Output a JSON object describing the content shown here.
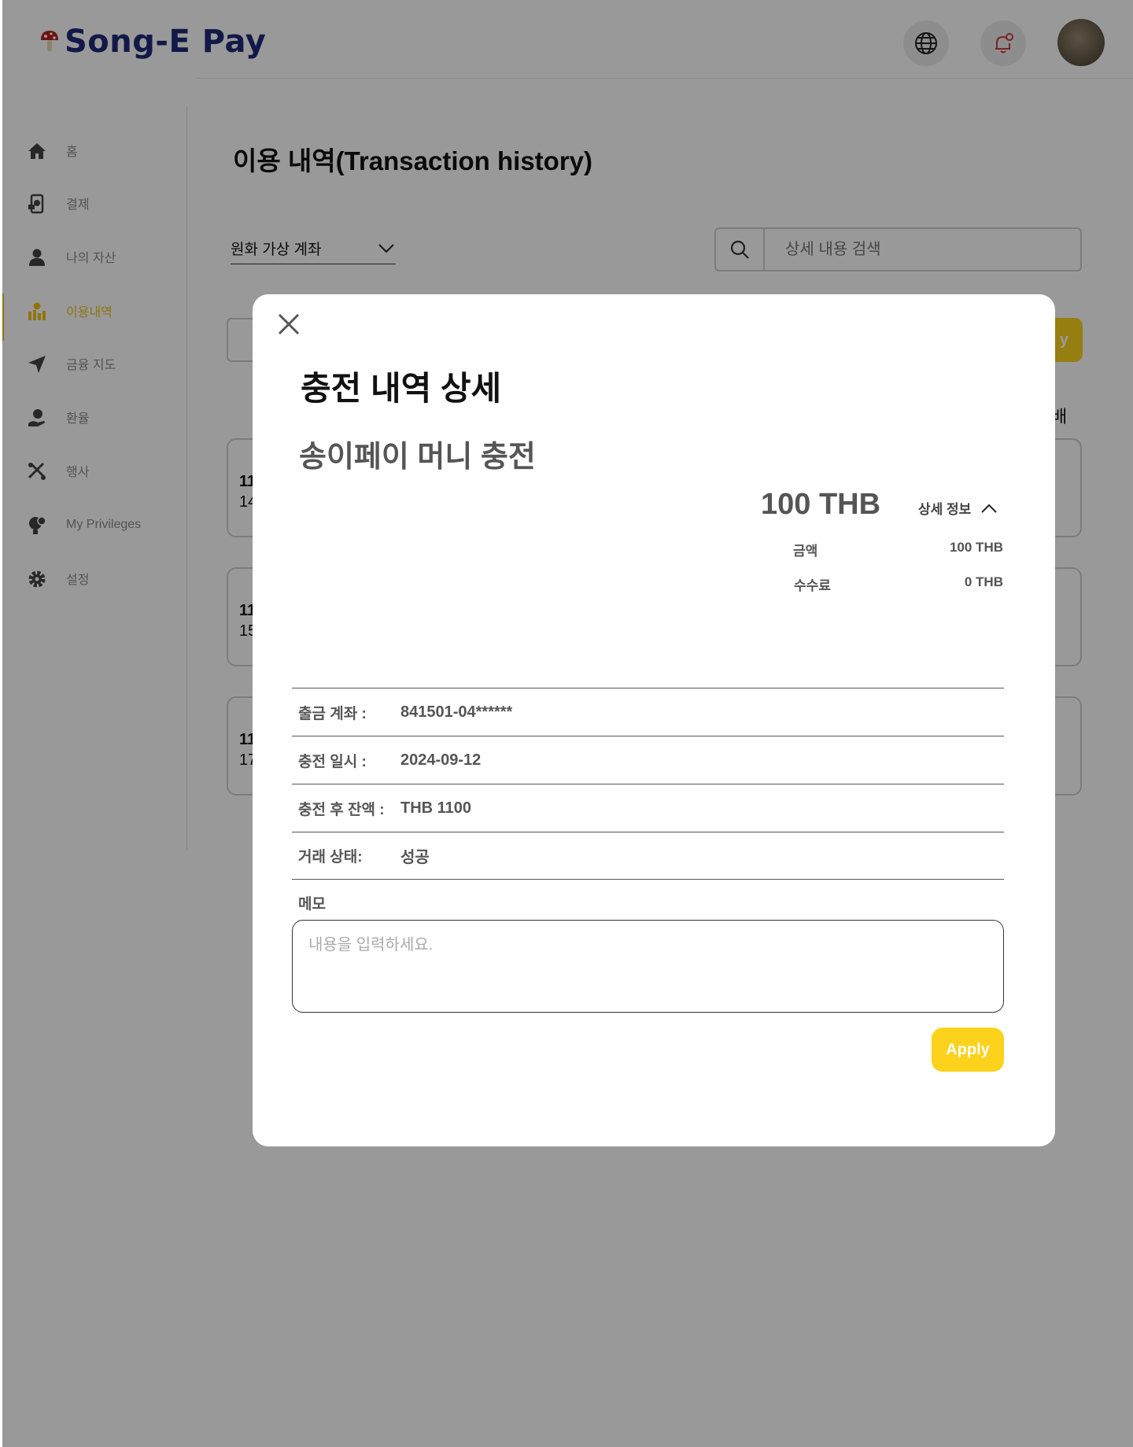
{
  "app": {
    "logo_text": "Song-E Pay"
  },
  "header": {
    "language_icon": "globe-icon",
    "notification_icon": "bell-icon"
  },
  "sidebar": {
    "items": [
      {
        "label": "홈",
        "icon": "home-icon"
      },
      {
        "label": "결제",
        "icon": "payment-icon"
      },
      {
        "label": "나의 자산",
        "icon": "user-icon"
      },
      {
        "label": "이용내역",
        "icon": "history-icon",
        "active": true
      },
      {
        "label": "금융 지도",
        "icon": "navigation-icon"
      },
      {
        "label": "환율",
        "icon": "exchange-icon"
      },
      {
        "label": "행사",
        "icon": "tools-icon"
      },
      {
        "label": "My Privileges",
        "icon": "privileges-icon"
      },
      {
        "label": "설정",
        "icon": "gear-icon"
      }
    ]
  },
  "main": {
    "page_title": "이용 내역(Transaction history)",
    "account_select": "원화 가상 계좌",
    "search_placeholder": "상세 내용 검색",
    "apply_partial": "y",
    "side_partial": "배",
    "cards": [
      {
        "line1": "11",
        "line2": "14"
      },
      {
        "line1": "11",
        "line2": "15"
      },
      {
        "line1": "11",
        "line2": "17"
      }
    ]
  },
  "modal": {
    "title": "충전 내역 상세",
    "subtitle": "송이페이 머니 충전",
    "amount": "100 THB",
    "detail_toggle": "상세 정보",
    "breakdown": [
      {
        "label": "금액",
        "value": "100 THB"
      },
      {
        "label": "수수료",
        "value": "0 THB"
      }
    ],
    "rows": [
      {
        "label": "출금 계좌 :",
        "value": "841501-04******"
      },
      {
        "label": "충전 일시 :",
        "value": "2024-09-12"
      },
      {
        "label": "충전 후 잔액 :",
        "value": "THB 1100"
      },
      {
        "label": "거래 상태:",
        "value": "성공"
      }
    ],
    "memo_label": "메모",
    "memo_placeholder": "내용을 입력하세요.",
    "apply_label": "Apply"
  },
  "colors": {
    "brand_navy": "#1e2a78",
    "accent_yellow": "#fcd21c",
    "active_nav": "#f0c419"
  }
}
